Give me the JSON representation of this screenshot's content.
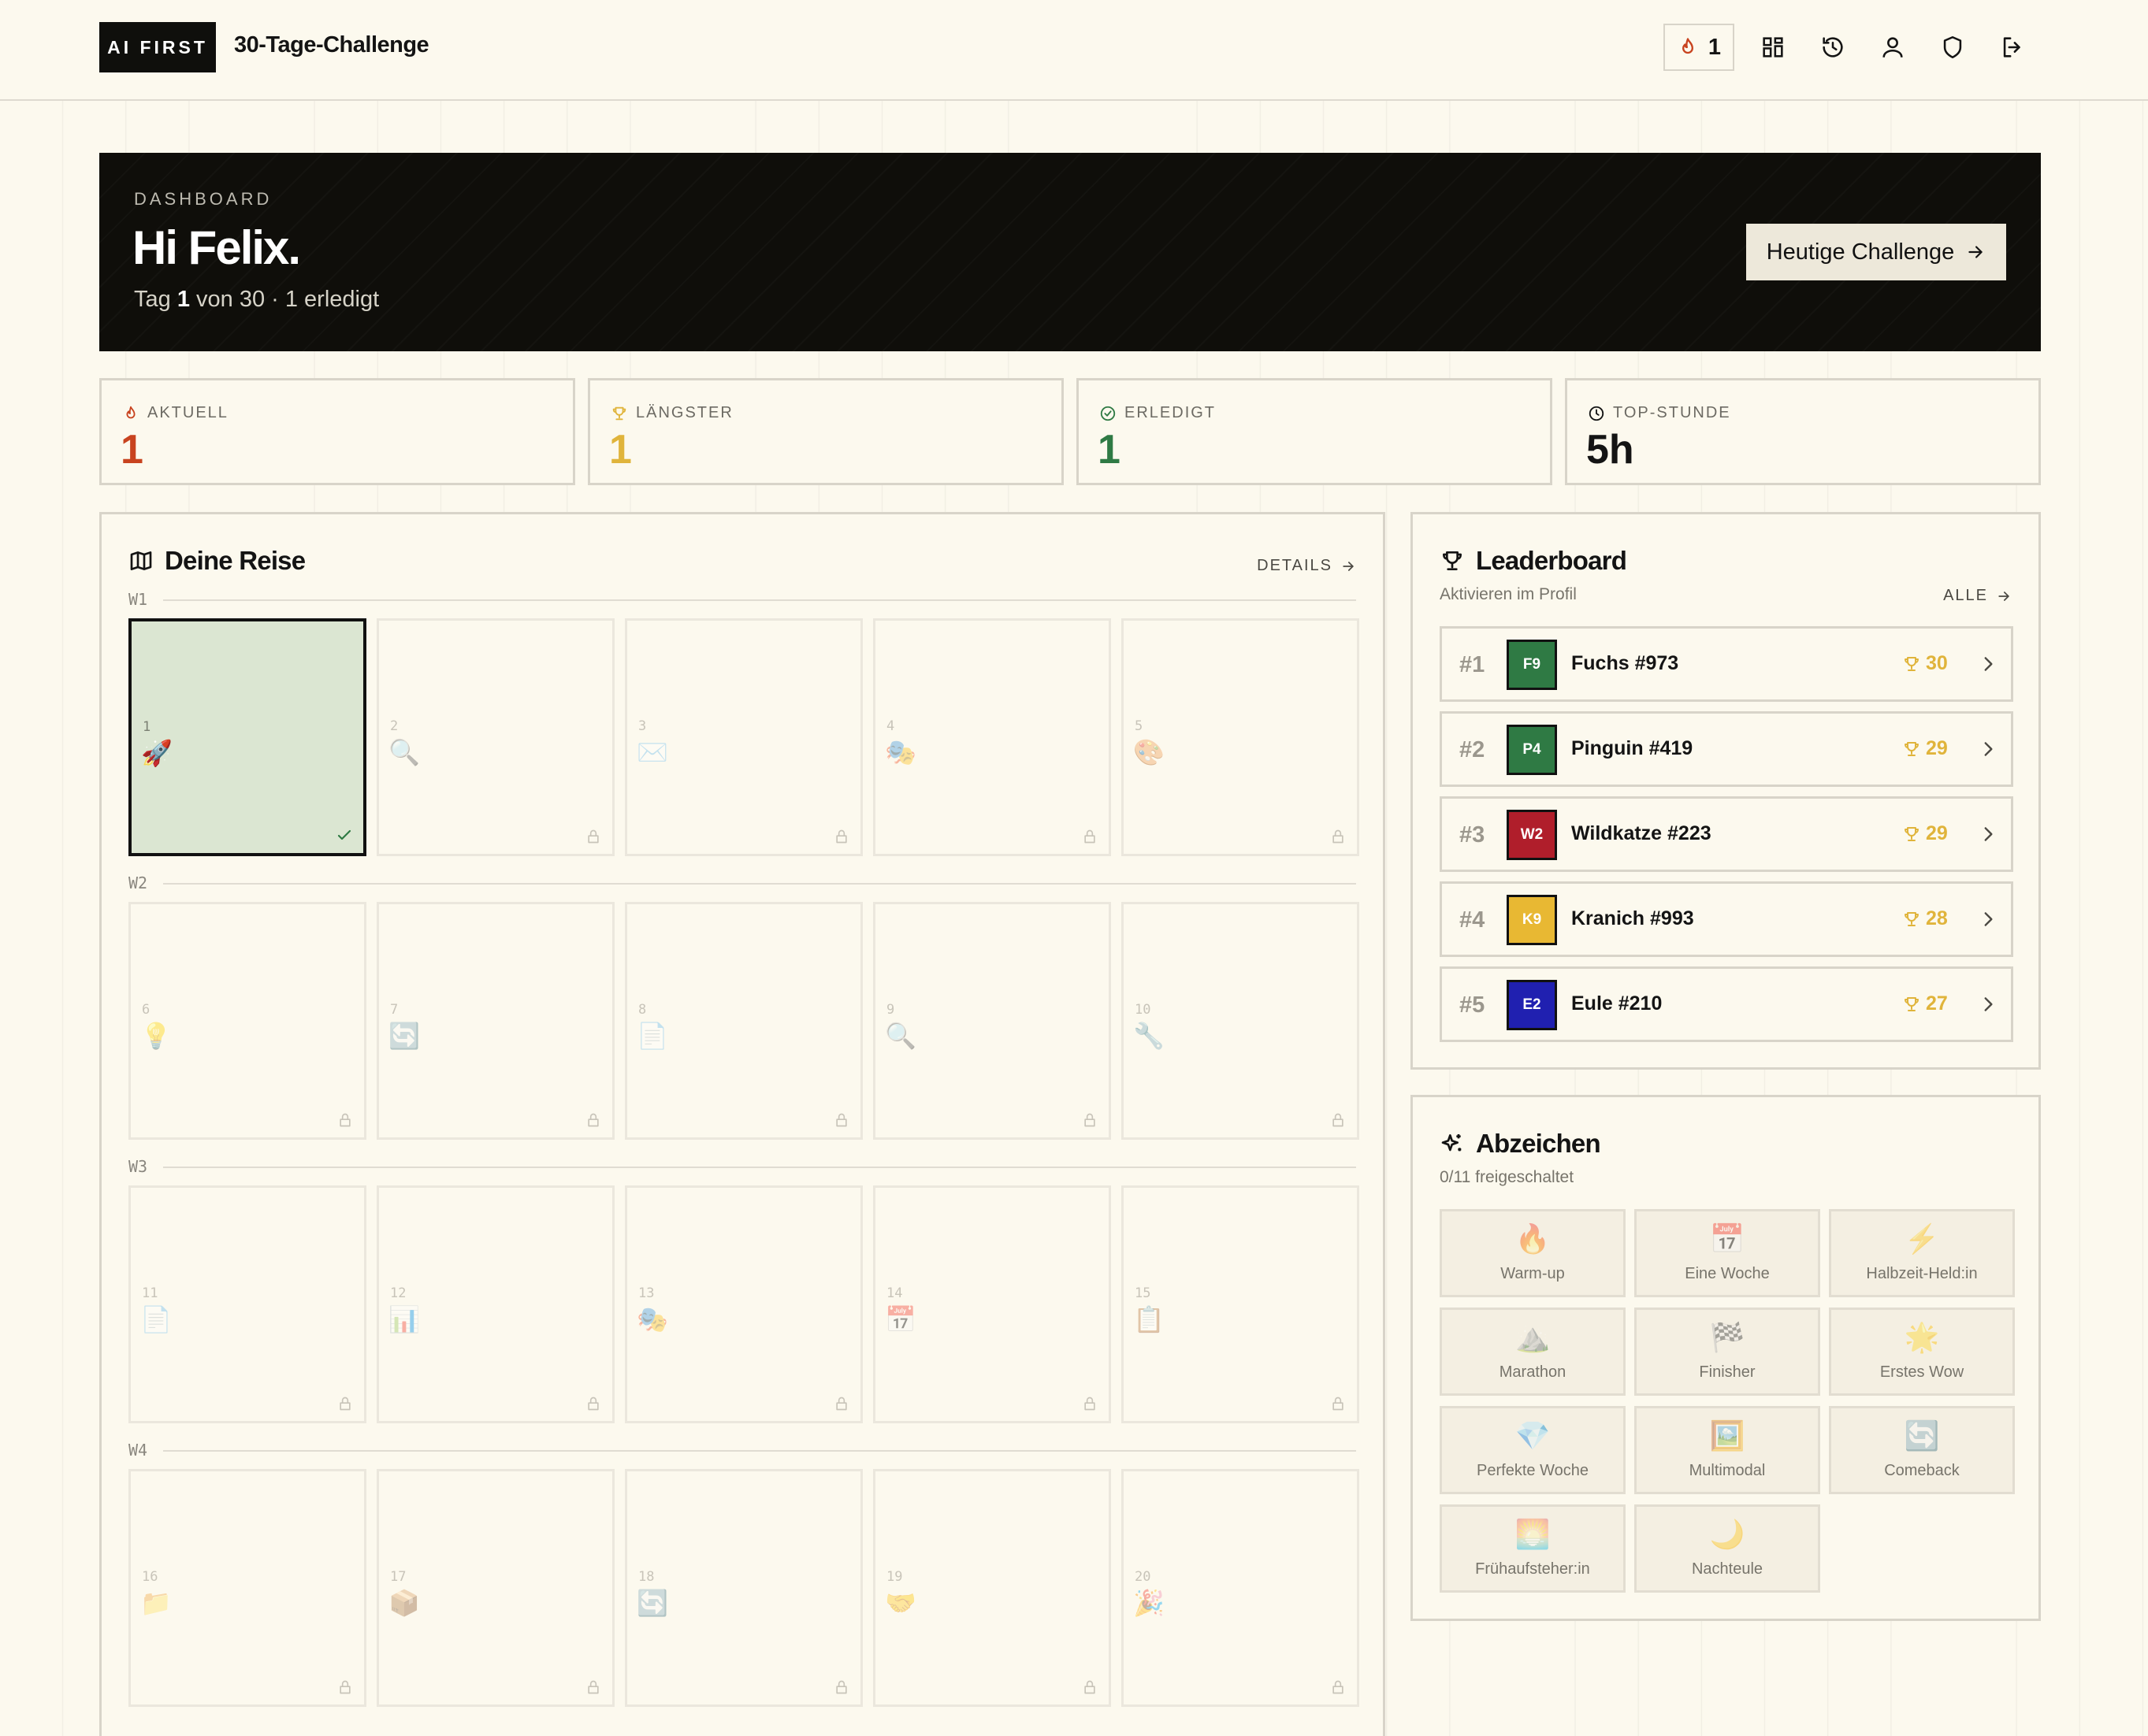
{
  "header": {
    "logo": "AI FIRST",
    "title": "30-Tage-Challenge",
    "streak_count": "1",
    "icons": [
      "fire-icon",
      "dashboard-grid-icon",
      "history-icon",
      "user-icon",
      "shield-icon",
      "logout-icon"
    ]
  },
  "hero": {
    "kicker": "DASHBOARD",
    "greeting": "Hi Felix.",
    "sub_prefix": "Tag ",
    "sub_day": "1",
    "sub_suffix": " von 30 · 1 erledigt",
    "cta_label": "Heutige Challenge"
  },
  "stats": [
    {
      "label": "AKTUELL",
      "value": "1",
      "color": "#c8431f",
      "icon": "fire-icon"
    },
    {
      "label": "LÄNGSTER",
      "value": "1",
      "color": "#e0b43b",
      "icon": "trophy-icon"
    },
    {
      "label": "ERLEDIGT",
      "value": "1",
      "color": "#2f7a44",
      "icon": "check-circle-icon"
    },
    {
      "label": "TOP-STUNDE",
      "value": "5h",
      "color": "#141414",
      "icon": "clock-icon"
    }
  ],
  "journey": {
    "title": "Deine Reise",
    "details_label": "DETAILS",
    "weeks": [
      {
        "label": "W1",
        "days": [
          {
            "num": "1",
            "emoji": "🚀",
            "state": "done"
          },
          {
            "num": "2",
            "emoji": "🔍",
            "state": "locked"
          },
          {
            "num": "3",
            "emoji": "✉️",
            "state": "locked"
          },
          {
            "num": "4",
            "emoji": "🎭",
            "state": "locked"
          },
          {
            "num": "5",
            "emoji": "🎨",
            "state": "locked"
          }
        ]
      },
      {
        "label": "W2",
        "days": [
          {
            "num": "6",
            "emoji": "💡",
            "state": "locked"
          },
          {
            "num": "7",
            "emoji": "🔄",
            "state": "locked"
          },
          {
            "num": "8",
            "emoji": "📄",
            "state": "locked"
          },
          {
            "num": "9",
            "emoji": "🔍",
            "state": "locked"
          },
          {
            "num": "10",
            "emoji": "🔧",
            "state": "locked"
          }
        ]
      },
      {
        "label": "W3",
        "days": [
          {
            "num": "11",
            "emoji": "📄",
            "state": "locked"
          },
          {
            "num": "12",
            "emoji": "📊",
            "state": "locked"
          },
          {
            "num": "13",
            "emoji": "🎭",
            "state": "locked"
          },
          {
            "num": "14",
            "emoji": "📅",
            "state": "locked"
          },
          {
            "num": "15",
            "emoji": "📋",
            "state": "locked"
          }
        ]
      },
      {
        "label": "W4",
        "days": [
          {
            "num": "16",
            "emoji": "📁",
            "state": "locked"
          },
          {
            "num": "17",
            "emoji": "📦",
            "state": "locked"
          },
          {
            "num": "18",
            "emoji": "🔄",
            "state": "locked"
          },
          {
            "num": "19",
            "emoji": "🤝",
            "state": "locked"
          },
          {
            "num": "20",
            "emoji": "🎉",
            "state": "locked"
          }
        ]
      }
    ]
  },
  "leaderboard": {
    "title": "Leaderboard",
    "subtitle": "Aktivieren im Profil",
    "all_label": "ALLE",
    "rows": [
      {
        "rank": "#1",
        "initials": "F9",
        "color": "#2f7a44",
        "name": "Fuchs #973",
        "score": "30"
      },
      {
        "rank": "#2",
        "initials": "P4",
        "color": "#2f7a44",
        "name": "Pinguin #419",
        "score": "29"
      },
      {
        "rank": "#3",
        "initials": "W2",
        "color": "#b01e2b",
        "name": "Wildkatze #223",
        "score": "29"
      },
      {
        "rank": "#4",
        "initials": "K9",
        "color": "#e8b833",
        "name": "Kranich #993",
        "score": "28"
      },
      {
        "rank": "#5",
        "initials": "E2",
        "color": "#2020b0",
        "name": "Eule #210",
        "score": "27"
      }
    ]
  },
  "badges": {
    "title": "Abzeichen",
    "subtitle": "0/11 freigeschaltet",
    "items": [
      {
        "icon": "🔥",
        "label": "Warm-up"
      },
      {
        "icon": "📅",
        "label": "Eine Woche"
      },
      {
        "icon": "⚡",
        "label": "Halbzeit-Held:in"
      },
      {
        "icon": "⛰️",
        "label": "Marathon"
      },
      {
        "icon": "🏁",
        "label": "Finisher"
      },
      {
        "icon": "🌟",
        "label": "Erstes Wow"
      },
      {
        "icon": "💎",
        "label": "Perfekte Woche"
      },
      {
        "icon": "🖼️",
        "label": "Multimodal"
      },
      {
        "icon": "🔄",
        "label": "Comeback"
      },
      {
        "icon": "🌅",
        "label": "Frühaufsteher:in"
      },
      {
        "icon": "🌙",
        "label": "Nachteule"
      }
    ]
  }
}
